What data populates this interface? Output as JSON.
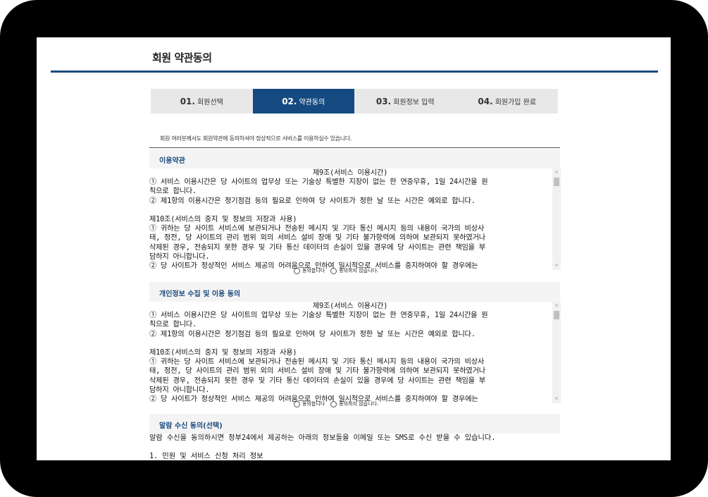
{
  "page": {
    "title": "회원 약관동의"
  },
  "steps": [
    {
      "num": "01.",
      "label": "회원선택"
    },
    {
      "num": "02.",
      "label": "약관동의"
    },
    {
      "num": "03.",
      "label": "회원정보 입력"
    },
    {
      "num": "04.",
      "label": "회원가입 완료"
    }
  ],
  "notice": "회원 여러분께서도 회원약관에 동의하셔야 정상적으로 서비스를 이용하실수 있습니다.",
  "section1": {
    "heading": "이용약관",
    "lines": [
      "제9조(서비스 이용시간)",
      "① 서비스 이용시간은 당 사이트의 업무상 또는 기술상 특별한 지장이 없는 한 연중무휴, 1일 24시간을 원",
      "칙으로 합니다.",
      "② 제1항의 이용시간은 정기점검 등의 필요로 인하여 당 사이트가 정한 날 또는 시간은 예외로 합니다.",
      "",
      "제10조(서비스의 중지 및 정보의 저장과 사용)",
      "① 귀하는 당 사이트 서비스에 보관되거나 전송된 메시지 및 기타 통신 메시지 등의 내용이 국가의 비상사",
      "태, 정전, 당 사이트의 관리 범위 외의 서비스 설비 장애 및 기타 불가항력에 의하여 보관되지 못하였거나",
      "삭제된 경우, 전송되지 못한 경우 및 기타 통신 데이터의 손실이 있을 경우에 당 사이트는 관련 책임을 부",
      "담하지 아니합니다.",
      "② 당 사이트가 정상적인 서비스 제공의 어려움으로 인하여 일시적으로 서비스를 중지하여야 할 경우에는"
    ],
    "agree": "동의합니다",
    "disagree": "동의하지 않습니다."
  },
  "section2": {
    "heading": "개인정보 수집 및 이용 동의",
    "lines": [
      "제9조(서비스 이용시간)",
      "① 서비스 이용시간은 당 사이트의 업무상 또는 기술상 특별한 지장이 없는 한 연중무휴, 1일 24시간을 원",
      "칙으로 합니다.",
      "② 제1항의 이용시간은 정기점검 등의 필요로 인하여 당 사이트가 정한 날 또는 시간은 예외로 합니다.",
      "",
      "제10조(서비스의 중지 및 정보의 저장과 사용)",
      "① 귀하는 당 사이트 서비스에 보관되거나 전송된 메시지 및 기타 통신 메시지 등의 내용이 국가의 비상사",
      "태, 정전, 당 사이트의 관리 범위 외의 서비스 설비 장애 및 기타 불가항력에 의하여 보관되지 못하였거나",
      "삭제된 경우, 전송되지 못한 경우 및 기타 통신 데이터의 손실이 있을 경우에 당 사이트는 관련 책임을 부",
      "담하지 아니합니다.",
      "② 당 사이트가 정상적인 서비스 제공의 어려움으로 인하여 일시적으로 서비스를 중지하여야 할 경우에는"
    ],
    "agree": "동의합니다",
    "disagree": "동의하지 않습니다."
  },
  "section3": {
    "heading": "알람 수신 동의(선택)",
    "lines": [
      "알람 수신을 동의하시면 정부24에서 제공하는 아래의 정보들을 이메일 또는 SMS로 수신 받을 수 있습니다.",
      "",
      "1. 민원 및 서비스 신청 처리 정보"
    ]
  }
}
